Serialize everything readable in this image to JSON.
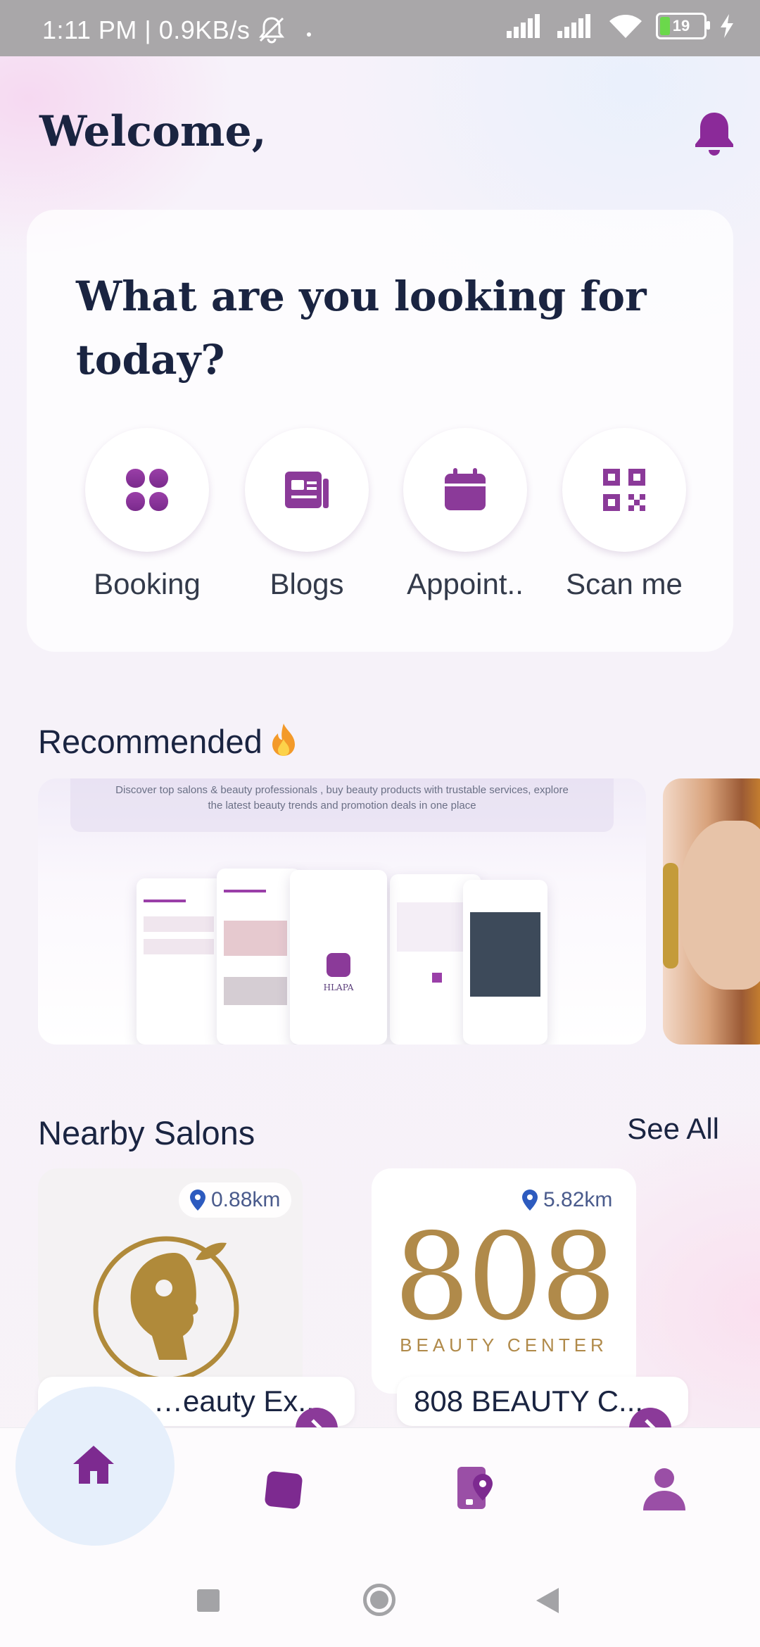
{
  "status_bar": {
    "time": "1:11 PM | 0.9KB/s",
    "battery": "19"
  },
  "header": {
    "welcome": "Welcome,"
  },
  "card": {
    "title": "What are you looking for today?",
    "actions": [
      {
        "label": "Booking",
        "icon": "booking-grid-icon"
      },
      {
        "label": "Blogs",
        "icon": "newspaper-icon"
      },
      {
        "label": "Appoint..",
        "icon": "calendar-icon"
      },
      {
        "label": "Scan me",
        "icon": "qr-code-icon"
      }
    ]
  },
  "recommended": {
    "title": "Recommended",
    "banner_text": "Discover top salons & beauty professionals , buy beauty products with trustable services, explore the latest beauty trends and promotion deals in one place",
    "app_name": "HLAPA"
  },
  "nearby": {
    "title": "Nearby Salons",
    "see_all": "See All",
    "salons": [
      {
        "name": "…eauty Ex...",
        "distance": "0.88km"
      },
      {
        "name": "808 BEAUTY C...",
        "distance": "5.82km",
        "logo_text": "808",
        "logo_sub": "BEAUTY CENTER"
      }
    ]
  },
  "colors": {
    "accent": "#8b3a99",
    "text_dark": "#1a2441",
    "gold": "#b08a4a"
  }
}
